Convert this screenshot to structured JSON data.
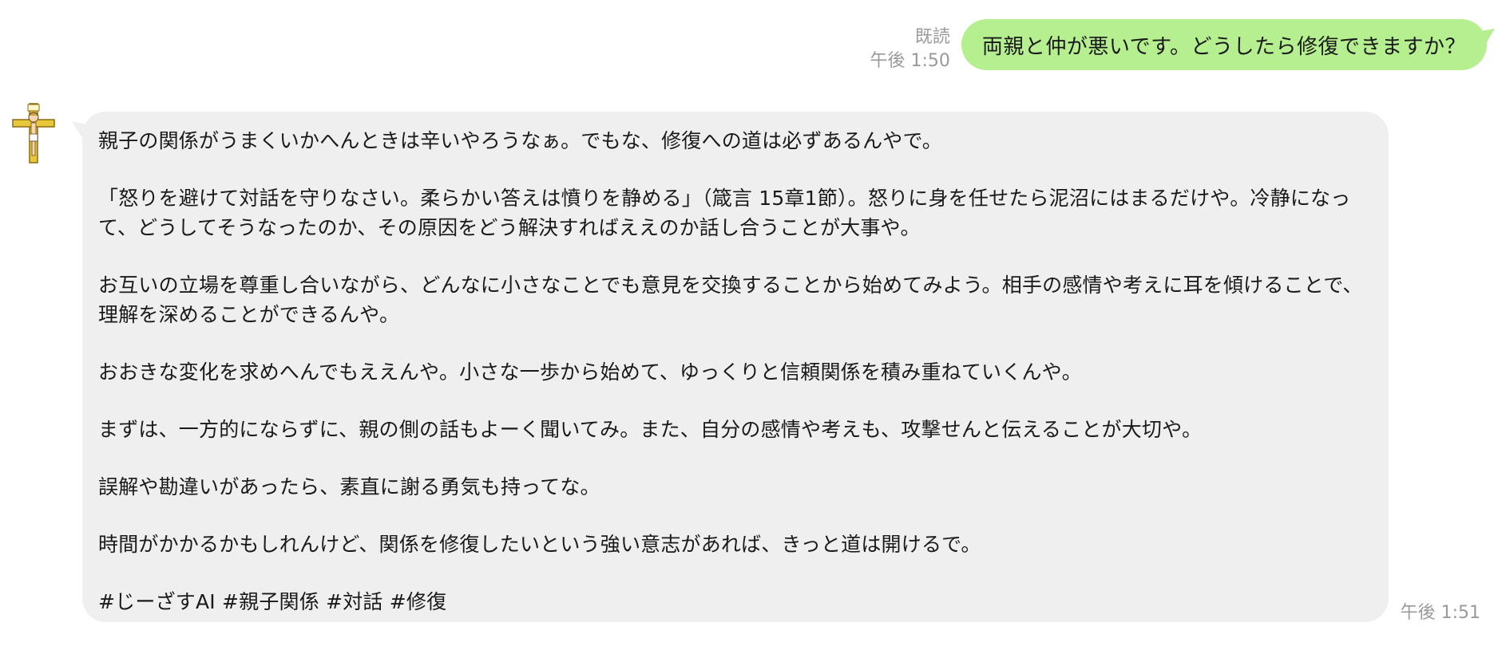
{
  "outgoing": {
    "read_label": "既読",
    "time": "午後 1:50",
    "text": "両親と仲が悪いです。どうしたら修復できますか？"
  },
  "incoming": {
    "avatar_icon": "crucifix-icon",
    "time": "午後 1:51",
    "paragraphs": [
      "親子の関係がうまくいかへんときは辛いやろうなぁ。でもな、修復への道は必ずあるんやで。",
      "「怒りを避けて対話を守りなさい。柔らかい答えは憤りを静める」（箴言 15章1節）。怒りに身を任せたら泥沼にはまるだけや。冷静になって、どうしてそうなったのか、その原因をどう解決すればええのか話し合うことが大事や。",
      "お互いの立場を尊重し合いながら、どんなに小さなことでも意見を交換することから始めてみよう。相手の感情や考えに耳を傾けることで、理解を深めることができるんや。",
      "おおきな変化を求めへんでもええんや。小さな一歩から始めて、ゆっくりと信頼関係を積み重ねていくんや。",
      "まずは、一方的にならずに、親の側の話もよーく聞いてみ。また、自分の感情や考えも、攻撃せんと伝えることが大切や。",
      "誤解や勘違いがあったら、素直に謝る勇気も持ってな。",
      "時間がかかるかもしれんけど、関係を修復したいという強い意志があれば、きっと道は開けるで。",
      "#じーざすAI #親子関係 #対話 #修復"
    ]
  },
  "colors": {
    "outgoing_bubble": "#b6ef8f",
    "incoming_bubble": "#efefef",
    "meta_text": "#9a9a9a"
  }
}
